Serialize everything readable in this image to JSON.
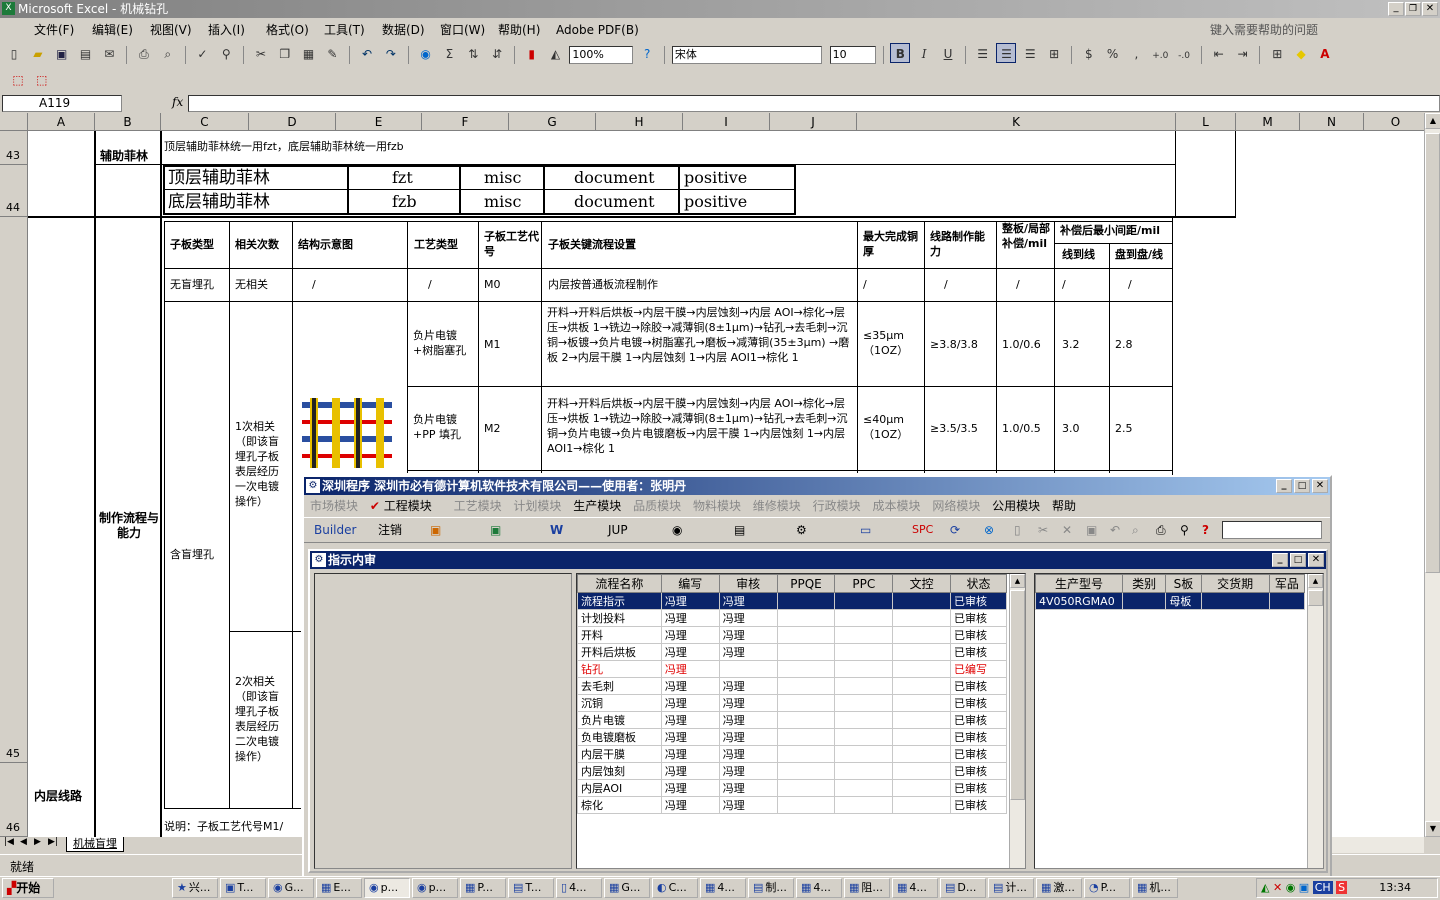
{
  "app": {
    "title": "Microsoft Excel - 机械钻孔",
    "help_prompt": "键入需要帮助的问题"
  },
  "menu": [
    "文件(F)",
    "编辑(E)",
    "视图(V)",
    "插入(I)",
    "格式(O)",
    "工具(T)",
    "数据(D)",
    "窗口(W)",
    "帮助(H)",
    "Adobe PDF(B)"
  ],
  "toolbar": {
    "zoom": "100%",
    "font": "宋体",
    "size": "10"
  },
  "formula": {
    "cell_ref": "A119",
    "fx": "fx"
  },
  "columns": [
    "A",
    "B",
    "C",
    "D",
    "E",
    "F",
    "G",
    "H",
    "I",
    "J",
    "K",
    "L",
    "M",
    "N",
    "O"
  ],
  "rows": {
    "r43": "43",
    "r44": "44",
    "r45": "45",
    "r46": "46"
  },
  "sheet": {
    "b43": "辅助菲林",
    "c43": "顶层辅助菲林统一用fzt，底层辅助菲林统一用fzb",
    "film_rows": [
      [
        "顶层辅助菲林",
        "fzt",
        "misc",
        "document",
        "positive"
      ],
      [
        "底层辅助菲林",
        "fzb",
        "misc",
        "document",
        "positive"
      ]
    ],
    "b45": "制作流程与能力",
    "a46": "内层线路",
    "th": [
      "子板类型",
      "相关次数",
      "结构示意图",
      "工艺类型",
      "子板工艺代号",
      "子板关键流程设置",
      "最大完成铜厚",
      "线路制作能力",
      "整板/局部补偿/mil",
      "补偿后最小间距/mil",
      "线到线",
      "盘到盘/线"
    ],
    "row_none": [
      "无盲埋孔",
      "无相关",
      "/",
      "/",
      "M0",
      "内层按普通板流程制作",
      "/",
      "/",
      "/",
      "/",
      "/"
    ],
    "row_m1": {
      "proc": "负片电镀+树脂塞孔",
      "code": "M1",
      "flow": "开料→开料后烘板→内层干膜→内层蚀刻→内层 AOI→棕化→层压→烘板 1→铣边→除胶→减薄铜(8±1μm)→钻孔→去毛刺→沉铜→板镀→负片电镀→树脂塞孔→磨板→减薄铜(35±3μm) →磨板 2→内层干膜 1→内层蚀刻 1→内层 AOI1→棕化 1",
      "cu": "≤35μm（1OZ）",
      "cap": "≥3.8/3.8",
      "comp": "1.0/0.6",
      "ll": "3.2",
      "pp": "2.8"
    },
    "row_m2": {
      "proc": "负片电镀+PP 填孔",
      "code": "M2",
      "flow": "开料→开料后烘板→内层干膜→内层蚀刻→内层 AOI→棕化→层压→烘板 1→铣边→除胶→减薄铜(8±1μm)→钻孔→去毛刺→沉铜→负片电镀→负片电镀磨板→内层干膜 1→内层蚀刻 1→内层 AOI1→棕化 1",
      "cu": "≤40μm（1OZ）",
      "cap": "≥3.5/3.5",
      "comp": "1.0/0.5",
      "ll": "3.0",
      "pp": "2.5"
    },
    "type_buried": "含盲埋孔",
    "rel1": "1次相关（即该盲埋孔子板表层经历一次电镀操作）",
    "rel2": "2次相关（即该盲埋孔子板表层经历二次电镀操作）",
    "note": "说明：子板工艺代号M1/",
    "tab": "机械盲埋"
  },
  "status": "就绪",
  "app_window": {
    "title": "深圳程序    深圳市必有德计算机软件技术有限公司——使用者：张明丹",
    "menu": [
      "市场模块",
      "工程模块",
      "工艺模块",
      "计划模块",
      "生产模块",
      "品质模块",
      "物料模块",
      "维修模块",
      "行政模块",
      "成本模块",
      "网络模块",
      "公用模块",
      "帮助"
    ],
    "builder": "Builder",
    "logout": "注销",
    "jup": "JUP",
    "spc": "SPC",
    "child_title": "指示内审",
    "grid_headers": [
      "流程名称",
      "编写",
      "审核",
      "PPQE",
      "PPC",
      "文控",
      "状态"
    ],
    "grid_rows": [
      [
        "流程指示",
        "冯理",
        "冯理",
        "",
        "",
        "",
        "已审核"
      ],
      [
        "计划投料",
        "冯理",
        "冯理",
        "",
        "",
        "",
        "已审核"
      ],
      [
        "开料",
        "冯理",
        "冯理",
        "",
        "",
        "",
        "已审核"
      ],
      [
        "开料后烘板",
        "冯理",
        "冯理",
        "",
        "",
        "",
        "已审核"
      ],
      [
        "钻孔",
        "冯理",
        "",
        "",
        "",
        "",
        "已编写"
      ],
      [
        "去毛刺",
        "冯理",
        "冯理",
        "",
        "",
        "",
        "已审核"
      ],
      [
        "沉铜",
        "冯理",
        "冯理",
        "",
        "",
        "",
        "已审核"
      ],
      [
        "负片电镀",
        "冯理",
        "冯理",
        "",
        "",
        "",
        "已审核"
      ],
      [
        "负电镀磨板",
        "冯理",
        "冯理",
        "",
        "",
        "",
        "已审核"
      ],
      [
        "内层干膜",
        "冯理",
        "冯理",
        "",
        "",
        "",
        "已审核"
      ],
      [
        "内层蚀刻",
        "冯理",
        "冯理",
        "",
        "",
        "",
        "已审核"
      ],
      [
        "内层AOI",
        "冯理",
        "冯理",
        "",
        "",
        "",
        "已审核"
      ],
      [
        "棕化",
        "冯理",
        "冯理",
        "",
        "",
        "",
        "已审核"
      ]
    ],
    "right_headers": [
      "生产型号",
      "类别",
      "S板",
      "交货期",
      "军品"
    ],
    "right_rows": [
      [
        "4V050RGMA0",
        "",
        "母板",
        "",
        ""
      ]
    ]
  },
  "taskbar": {
    "start": "开始",
    "clock": "13:34",
    "ime": "中",
    "lang": "CH",
    "tasks": [
      "兴...",
      "T...",
      "G...",
      "E...",
      "p...",
      "p...",
      "P...",
      "T...",
      "4...",
      "G...",
      "C...",
      "4...",
      "制...",
      "4...",
      "阻...",
      "4...",
      "D...",
      "计...",
      "激...",
      "P...",
      "机..."
    ]
  }
}
